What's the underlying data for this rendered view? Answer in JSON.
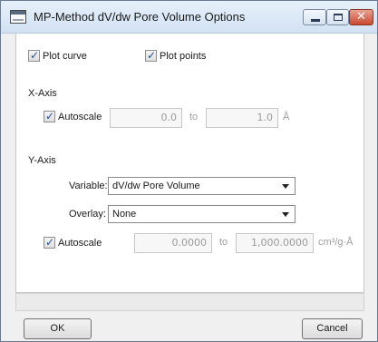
{
  "window": {
    "title": "MP-Method dV/dw Pore Volume Options",
    "minimize_icon": "minimize-icon",
    "maximize_icon": "maximize-icon",
    "close_glyph": "✕"
  },
  "options": {
    "plot_curve": {
      "label": "Plot curve",
      "checked": true
    },
    "plot_points": {
      "label": "Plot points",
      "checked": true
    }
  },
  "x_axis": {
    "heading": "X-Axis",
    "autoscale": {
      "label": "Autoscale",
      "checked": true
    },
    "min": "0.0",
    "to": "to",
    "max": "1.0",
    "unit": "Å"
  },
  "y_axis": {
    "heading": "Y-Axis",
    "variable_label": "Variable:",
    "variable_value": "dV/dw Pore Volume",
    "overlay_label": "Overlay:",
    "overlay_value": "None",
    "autoscale": {
      "label": "Autoscale",
      "checked": true
    },
    "min": "0.0000",
    "to": "to",
    "max": "1,000.0000",
    "unit": "cm³/g·Å"
  },
  "buttons": {
    "ok": "OK",
    "cancel": "Cancel"
  },
  "colors": {
    "title_bar": "#dae7f5",
    "close_button": "#c74a30",
    "check_mark": "#2a4f8f"
  }
}
